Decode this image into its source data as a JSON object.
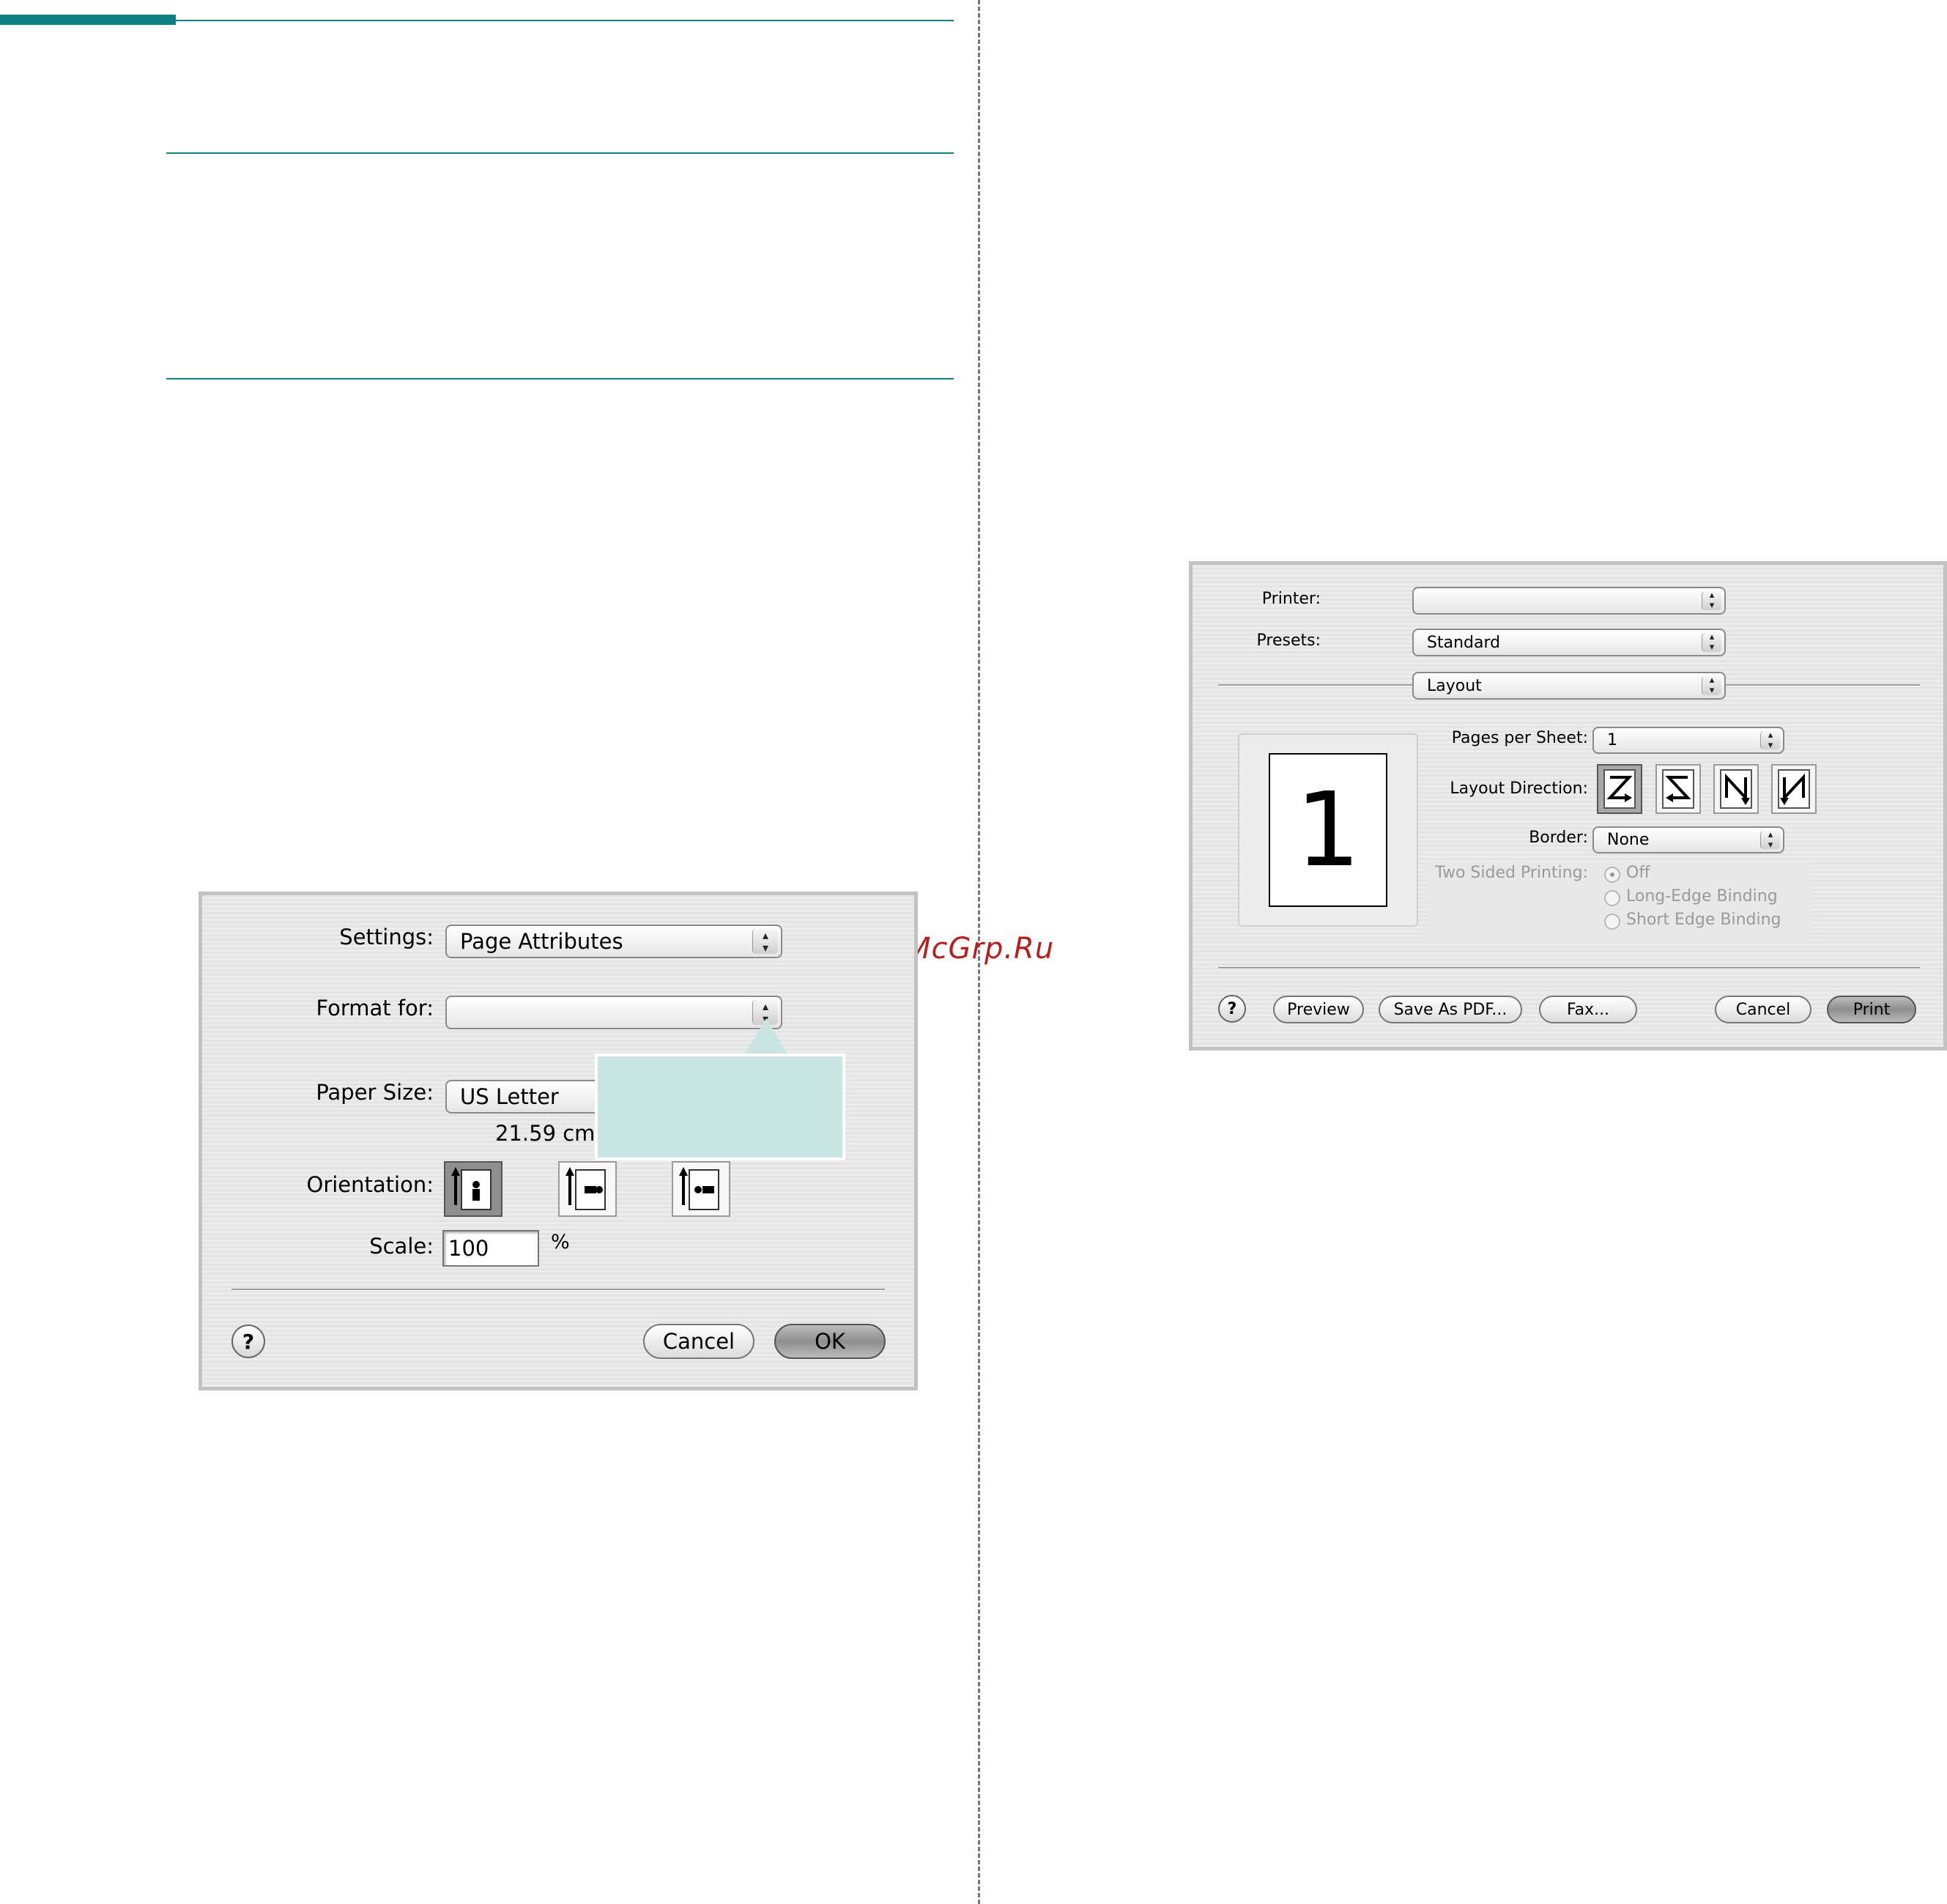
{
  "watermark": "McGrp.Ru",
  "page_setup": {
    "settings_label": "Settings:",
    "settings_value": "Page Attributes",
    "format_for_label": "Format for:",
    "format_for_value": "",
    "paper_size_label": "Paper Size:",
    "paper_size_value": "US Letter",
    "paper_dims": "21.59 cm",
    "orientation_label": "Orientation:",
    "scale_label": "Scale:",
    "scale_value": "100",
    "scale_unit": "%",
    "help_label": "?",
    "cancel_label": "Cancel",
    "ok_label": "OK"
  },
  "print": {
    "printer_label": "Printer:",
    "printer_value": "",
    "presets_label": "Presets:",
    "presets_value": "Standard",
    "panel_value": "Layout",
    "preview_number": "1",
    "pages_per_sheet_label": "Pages per Sheet:",
    "pages_per_sheet_value": "1",
    "layout_direction_label": "Layout Direction:",
    "border_label": "Border:",
    "border_value": "None",
    "two_sided_label": "Two Sided Printing:",
    "two_sided_options": [
      "Off",
      "Long-Edge Binding",
      "Short Edge Binding"
    ],
    "help_label": "?",
    "preview_label": "Preview",
    "save_pdf_label": "Save As PDF...",
    "fax_label": "Fax...",
    "cancel_label": "Cancel",
    "print_label": "Print"
  }
}
